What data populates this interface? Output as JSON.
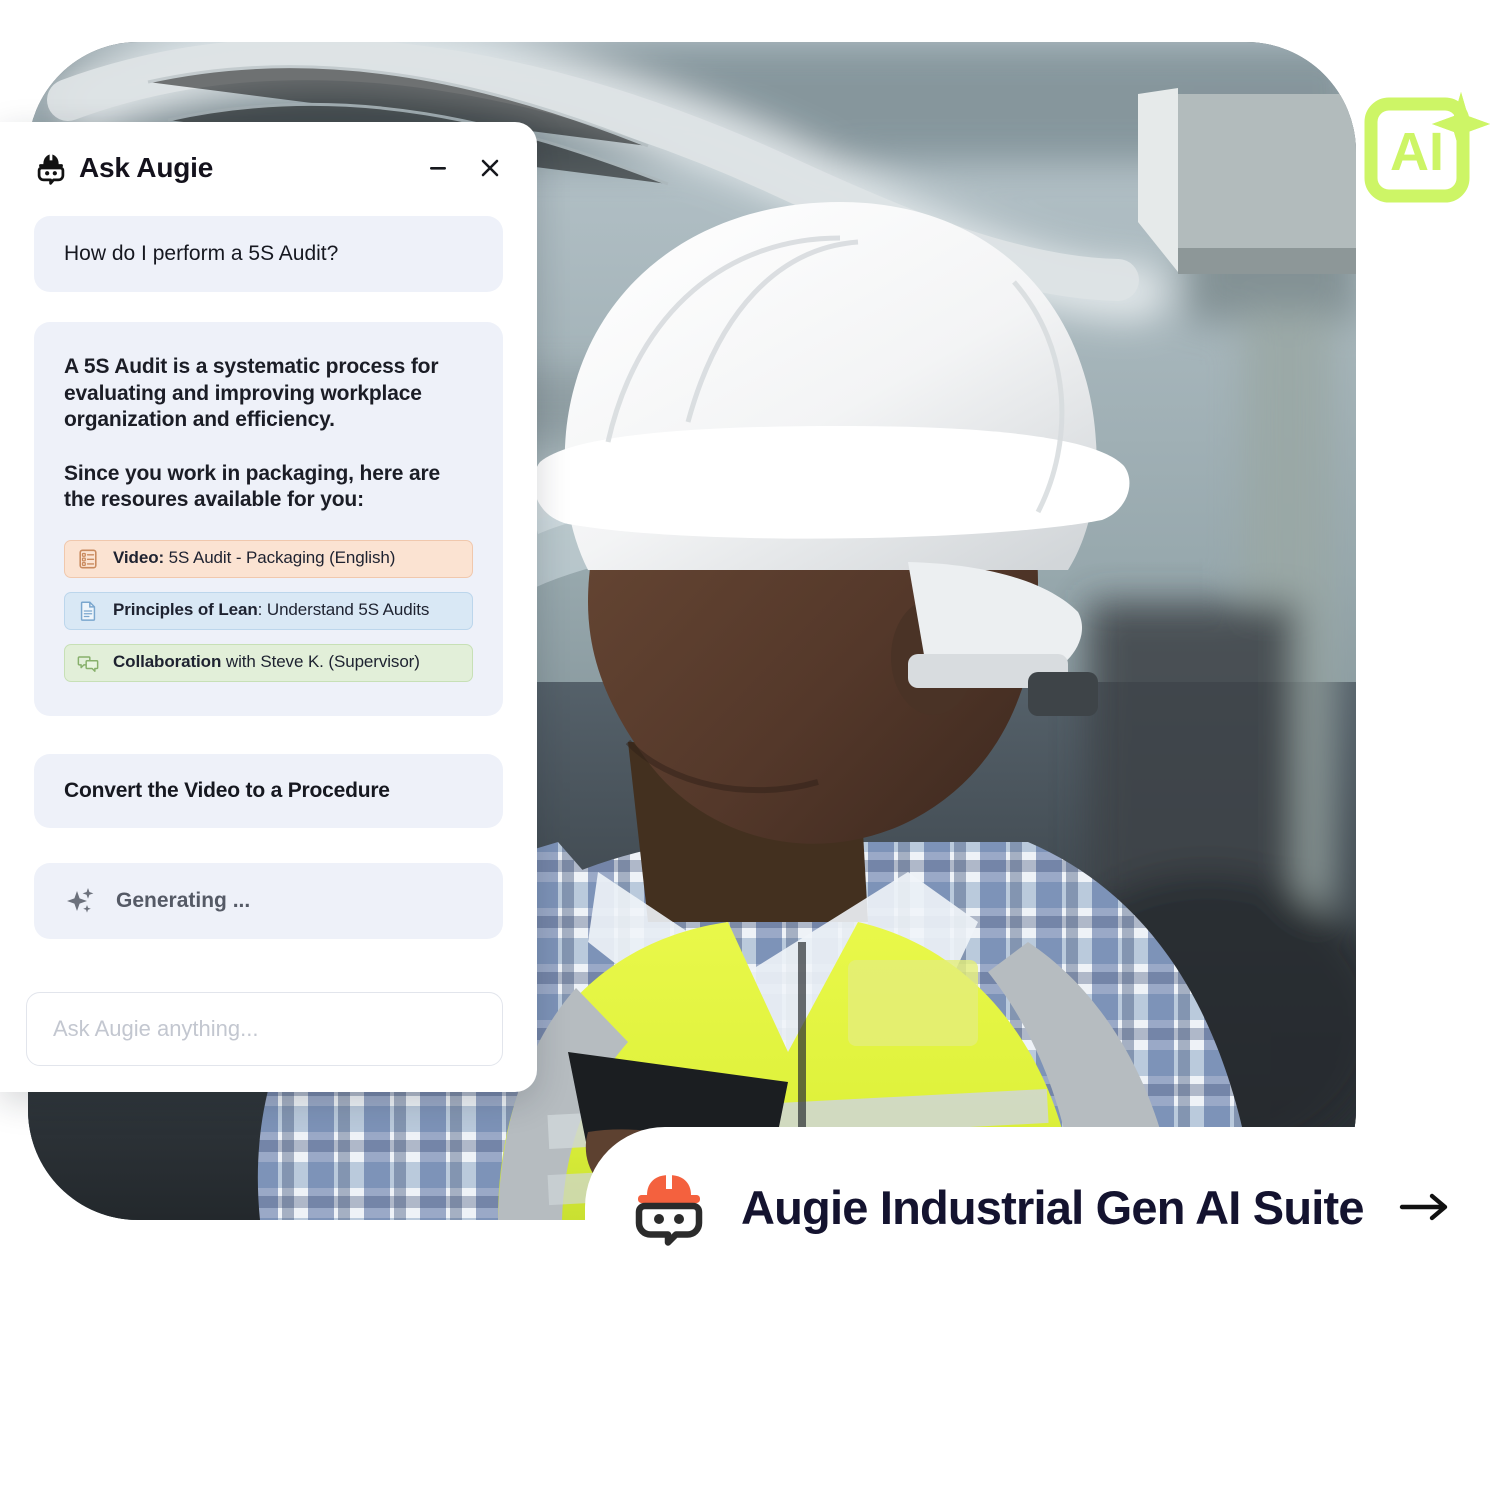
{
  "panel": {
    "title": "Ask Augie",
    "logo_icon": "augie-mascot-icon",
    "minimize_label": "−",
    "close_label": "×",
    "user_message": "How do I perform a 5S Audit?",
    "answer_paragraph_1": "A 5S Audit is a systematic process for evaluating and improving workplace organization and efficiency.",
    "answer_paragraph_2": "Since you work in packaging, here are the resoures available for you:",
    "resources": [
      {
        "icon": "checklist-icon",
        "label": "Video:",
        "detail": " 5S Audit - Packaging (English)",
        "color": "#FBE3D2"
      },
      {
        "icon": "document-icon",
        "label": "Principles of Lean",
        "detail": ": Understand 5S Audits",
        "color": "#D9E8F5"
      },
      {
        "icon": "chat-bubbles-icon",
        "label": "Collaboration",
        "detail": " with Steve K. (Supervisor)",
        "color": "#E2EFD9"
      }
    ],
    "action_label": "Convert the Video to a Procedure",
    "status_icon": "sparkle-icon",
    "status_text": "Generating ...",
    "composer_placeholder": "Ask Augie anything...",
    "composer_value": ""
  },
  "badge": {
    "icon": "ai-sparkle-badge-icon",
    "text": "AI",
    "color": "#CDF566"
  },
  "banner": {
    "logo_icon": "augie-mascot-icon",
    "title": "Augie Industrial Gen AI Suite",
    "arrow_icon": "arrow-right-icon",
    "title_color": "#14132F",
    "logo_color": "#F4613E"
  },
  "photo": {
    "alt": "industrial worker wearing white hard hat, safety glasses and hi-vis vest holding a tablet"
  }
}
